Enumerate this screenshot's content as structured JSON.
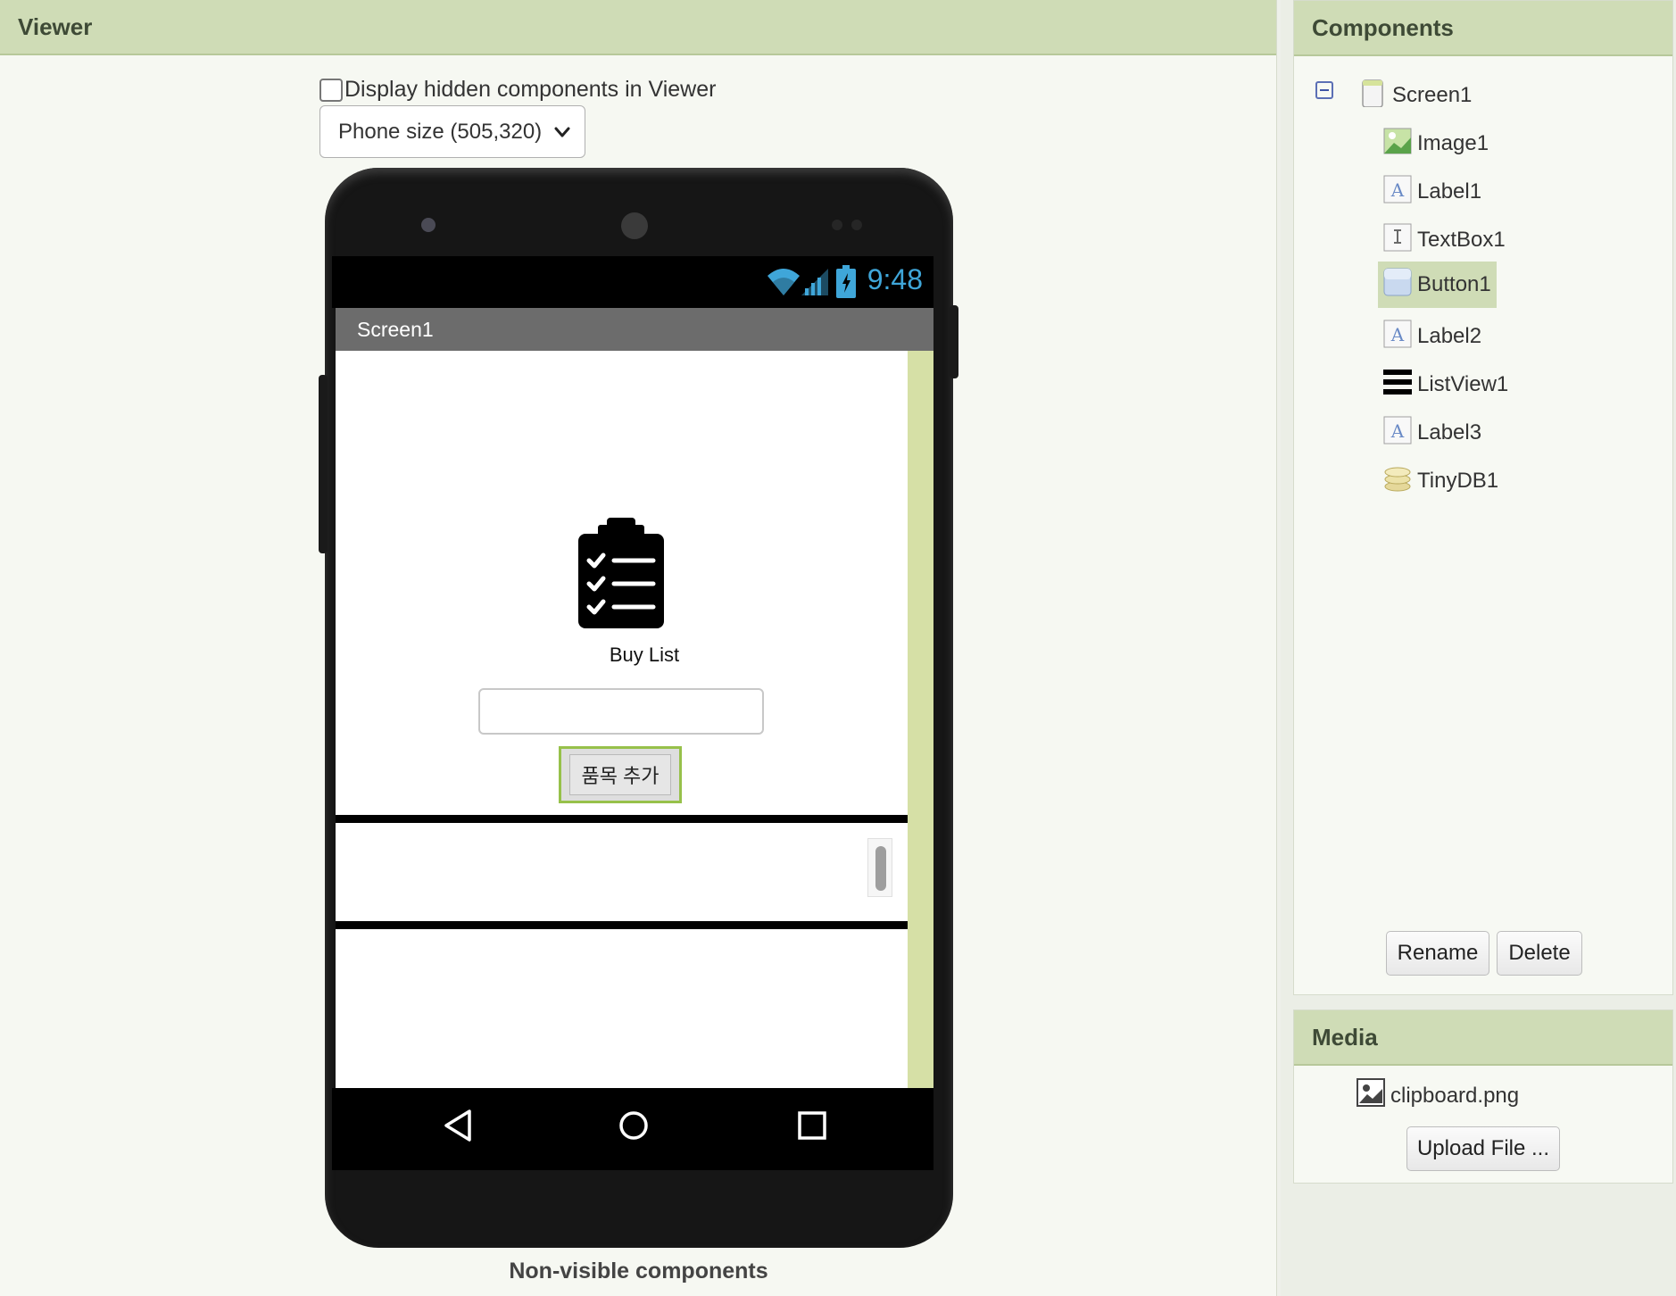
{
  "viewer": {
    "header": "Viewer",
    "hidden_checkbox_label": "Display hidden components in Viewer",
    "size_select_value": "Phone size (505,320)",
    "nonvisible_label": "Non-visible components"
  },
  "phone": {
    "status_time": "9:48",
    "screen_title": "Screen1",
    "label_text": "Buy List",
    "textbox_value": "",
    "button_label": "품목 추가"
  },
  "components": {
    "header": "Components",
    "root": "Screen1",
    "items": [
      {
        "label": "Image1",
        "icon": "image-icon"
      },
      {
        "label": "Label1",
        "icon": "label-icon"
      },
      {
        "label": "TextBox1",
        "icon": "textbox-icon"
      },
      {
        "label": "Button1",
        "icon": "button-icon",
        "selected": true
      },
      {
        "label": "Label2",
        "icon": "label-icon"
      },
      {
        "label": "ListView1",
        "icon": "listview-icon"
      },
      {
        "label": "Label3",
        "icon": "label-icon"
      },
      {
        "label": "TinyDB1",
        "icon": "database-icon"
      }
    ],
    "rename_label": "Rename",
    "delete_label": "Delete"
  },
  "media": {
    "header": "Media",
    "file": "clipboard.png",
    "upload_label": "Upload File ..."
  },
  "colors": {
    "header_bg": "#cfdcb6",
    "selected_bg": "#cfdcb6",
    "button_highlight": "#97c14a",
    "clock": "#3fa6d9"
  }
}
